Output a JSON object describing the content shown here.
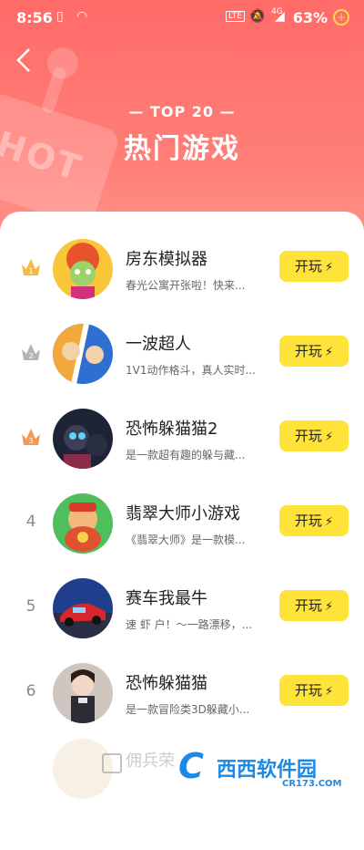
{
  "status_bar": {
    "time": "8:56",
    "network": "4G",
    "battery": "63%"
  },
  "header": {
    "top_label": "— TOP 20 —",
    "title": "热门游戏",
    "decoration_text": "HOT"
  },
  "games": [
    {
      "rank": "1",
      "name": "房东模拟器",
      "desc": "春光公寓开张啦！快来...",
      "button": "开玩"
    },
    {
      "rank": "2",
      "name": "一波超人",
      "desc": "1V1动作格斗，真人实时...",
      "button": "开玩"
    },
    {
      "rank": "3",
      "name": "恐怖躲猫猫2",
      "desc": "是一款超有趣的躲与藏...",
      "button": "开玩"
    },
    {
      "rank": "4",
      "name": "翡翠大师小游戏",
      "desc": "《翡翠大师》是一款模...",
      "button": "开玩"
    },
    {
      "rank": "5",
      "name": "赛车我最牛",
      "desc": "速 虾 户！～一路漂移，...",
      "button": "开玩"
    },
    {
      "rank": "6",
      "name": "恐怖躲猫猫",
      "desc": "是一款冒险类3D躲藏小...",
      "button": "开玩"
    }
  ],
  "partial_row": {
    "name": "佣兵荣"
  },
  "watermark": {
    "text": "西西软件园",
    "sub": "CR173.COM"
  },
  "colors": {
    "header": "#ff6b68",
    "button": "#ffe338",
    "crown_gold": "#f5b93b",
    "crown_silver": "#b5b5b5",
    "crown_bronze": "#f09a5a"
  }
}
